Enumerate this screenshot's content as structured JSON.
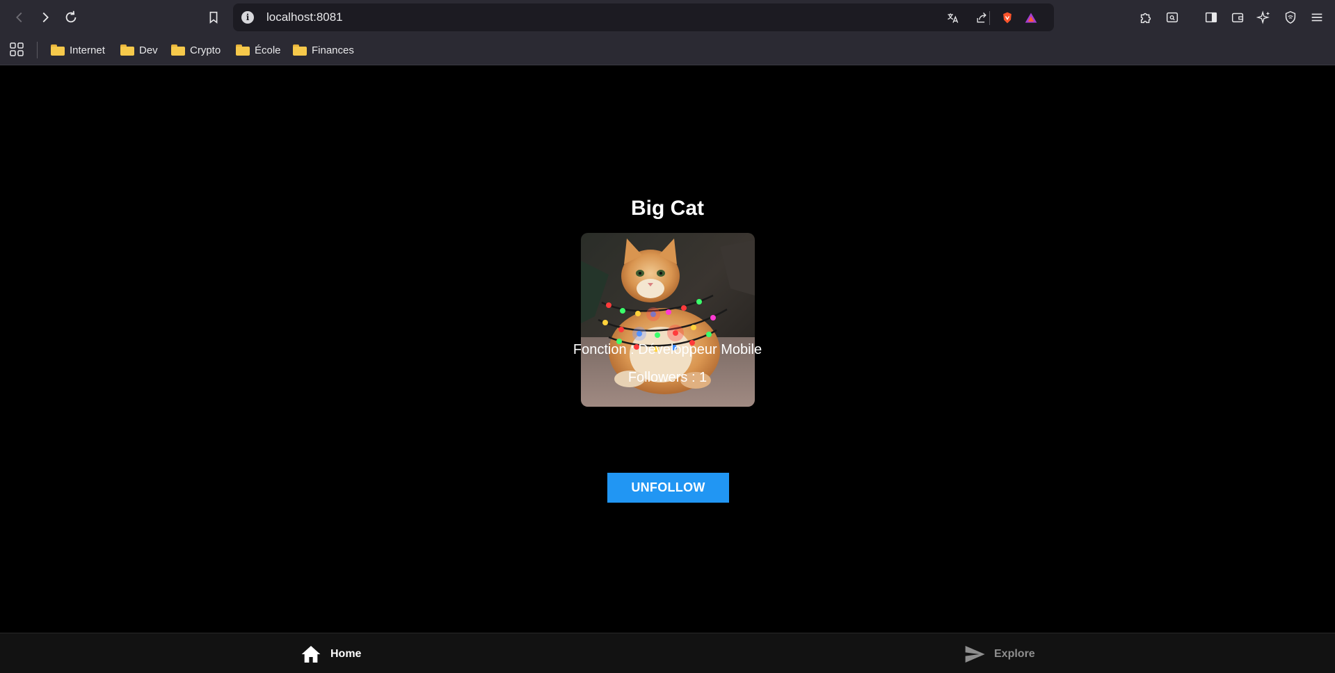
{
  "browser": {
    "url": "localhost:8081",
    "bookmarks": [
      {
        "label": "Internet"
      },
      {
        "label": "Dev"
      },
      {
        "label": "Crypto"
      },
      {
        "label": "École"
      },
      {
        "label": "Finances"
      }
    ]
  },
  "profile": {
    "name": "Big Cat",
    "fonction": "Fonction : Développeur Mobile",
    "followers": "Followers : 1",
    "button_label": "UNFOLLOW"
  },
  "tabs": [
    {
      "label": "Home",
      "icon": "home-icon",
      "active": true
    },
    {
      "label": "Explore",
      "icon": "send-icon",
      "active": false
    }
  ],
  "colors": {
    "accent": "#2196f3",
    "tab_active": "#ffffff",
    "tab_inactive": "#8e8e8e",
    "background": "#000000"
  }
}
